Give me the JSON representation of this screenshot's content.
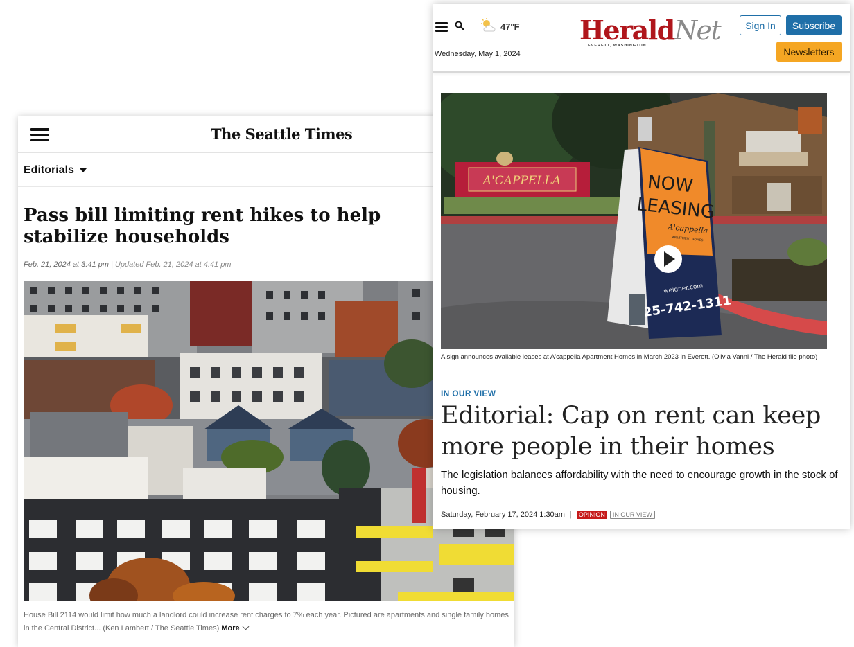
{
  "seattle_times": {
    "logo": "The Seattle Times",
    "section": "Editorials",
    "headline": "Pass bill limiting rent hikes to help stabilize households",
    "published": "Feb. 21, 2024 at 3:41 pm",
    "updated": "Updated Feb. 21, 2024 at 4:41 pm",
    "photo_alt": "Apartments and single family homes in the Central District",
    "caption": "House Bill 2114 would limit how much a landlord could increase rent charges to 7% each year. Pictured are apartments and single family homes in the Central District... (Ken Lambert / The Seattle Times)",
    "more_label": "More"
  },
  "herald": {
    "temperature": "47°F",
    "date": "Wednesday, May 1, 2024",
    "logo_main": "Herald",
    "logo_net": "Net",
    "logo_location": "EVERETT, WASHINGTON",
    "signin_label": "Sign In",
    "subscribe_label": "Subscribe",
    "newsletters_label": "Newsletters",
    "photo_alt": "Now leasing sign at A'cappella Apartment Homes",
    "sign": {
      "brand": "A'CAPPELLA",
      "line1": "NOW",
      "line2": "LEASING",
      "brand_small": "A'cappella",
      "brand_small_sub": "APARTMENT HOMES",
      "url": "weidner.com",
      "phone": "425-742-1311"
    },
    "caption": "A sign announces available leases at A'cappella Apartment Homes in March 2023 in Everett. (Olivia Vanni / The Herald file photo)",
    "kicker": "IN OUR VIEW",
    "headline": "Editorial: Cap on rent can keep more people in their homes",
    "summary": "The legislation balances affordability with the need to encourage growth in the stock of housing.",
    "timestamp": "Saturday, February 17, 2024 1:30am",
    "separator": "|",
    "tags": [
      "OPINION",
      "IN OUR VIEW"
    ]
  },
  "colors": {
    "herald_red": "#b0161c",
    "herald_blue": "#1f6fa8",
    "newsletters_orange": "#f5a623",
    "opinion_red": "#c61a1a"
  },
  "icons": [
    "hamburger-icon",
    "search-icon",
    "weather-partly-cloudy-icon",
    "caret-down-icon",
    "chevron-down-icon",
    "play-icon"
  ]
}
